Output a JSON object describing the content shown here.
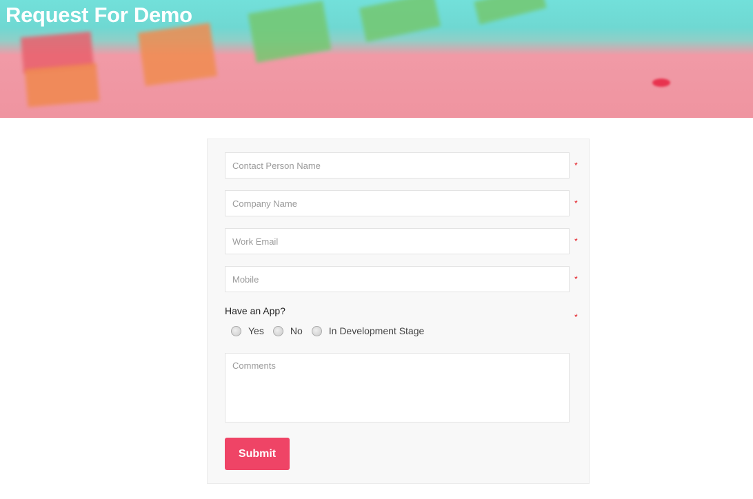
{
  "header": {
    "title": "Request For Demo"
  },
  "form": {
    "fields": [
      {
        "placeholder": "Contact Person Name",
        "required": "*"
      },
      {
        "placeholder": "Company Name",
        "required": "*"
      },
      {
        "placeholder": "Work Email",
        "required": "*"
      },
      {
        "placeholder": "Mobile",
        "required": "*"
      }
    ],
    "app_question": {
      "label": "Have an App?",
      "required": "*",
      "options": [
        "Yes",
        "No",
        "In Development Stage"
      ]
    },
    "comments": {
      "placeholder": "Comments"
    },
    "submit_label": "Submit"
  },
  "colors": {
    "accent": "#ef4466",
    "required": "#e3131b"
  }
}
